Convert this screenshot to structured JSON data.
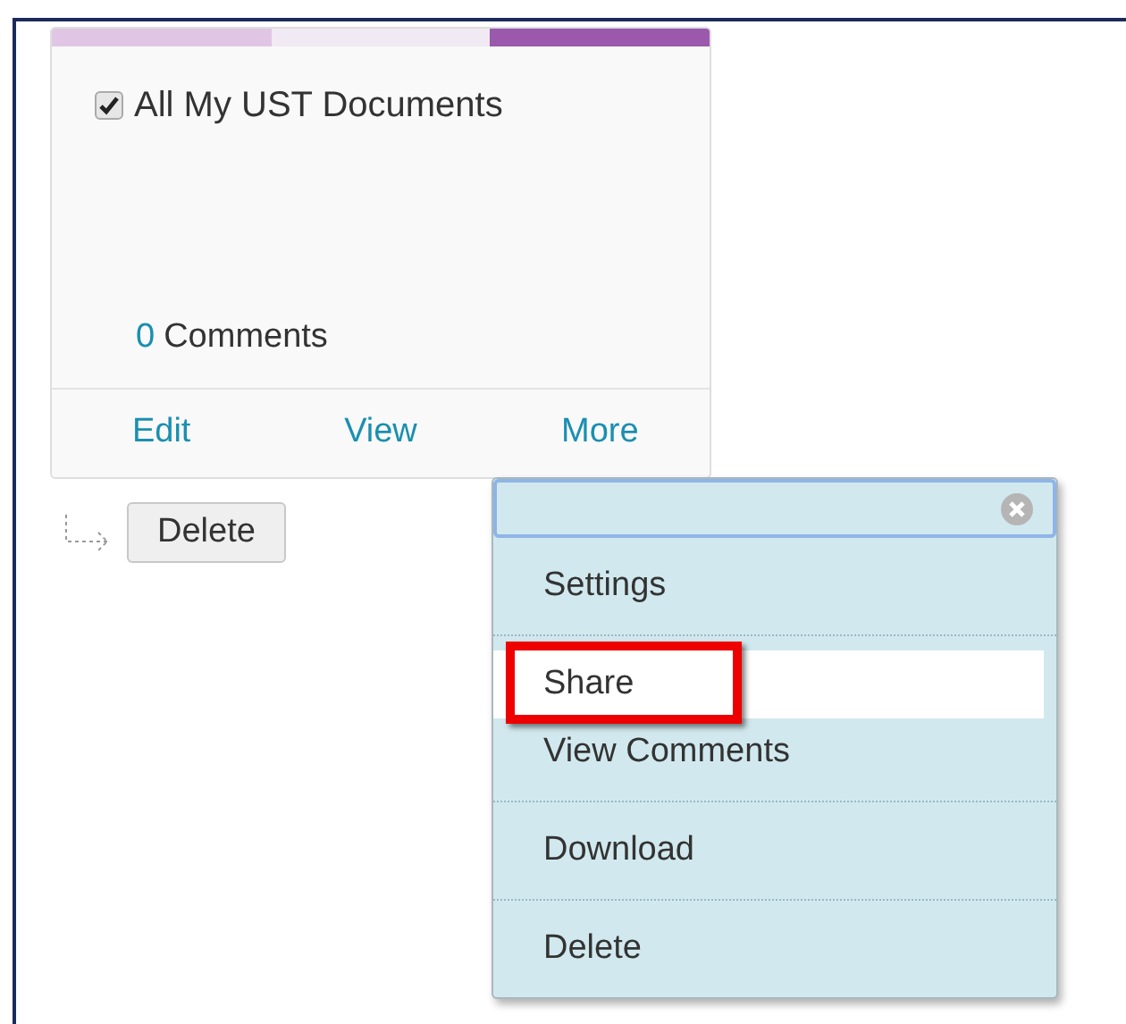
{
  "card": {
    "strip": [
      {
        "color": "#e0c6e4"
      },
      {
        "color": "#f1e9f3"
      },
      {
        "color": "#9b59ad"
      }
    ],
    "checkbox": {
      "checked": true,
      "label": "All My UST Documents"
    },
    "comments": {
      "count": "0",
      "label": "Comments"
    },
    "actions": [
      "Edit",
      "View",
      "More"
    ]
  },
  "delete_button": "Delete",
  "menu": {
    "groups": [
      [
        {
          "label": "Settings",
          "selected": false,
          "annotated": false
        }
      ],
      [
        {
          "label": "Share",
          "selected": true,
          "annotated": true
        },
        {
          "label": "View Comments",
          "selected": false,
          "annotated": false
        }
      ],
      [
        {
          "label": "Download",
          "selected": false,
          "annotated": false
        }
      ],
      [
        {
          "label": "Delete",
          "selected": false,
          "annotated": false
        }
      ]
    ]
  }
}
